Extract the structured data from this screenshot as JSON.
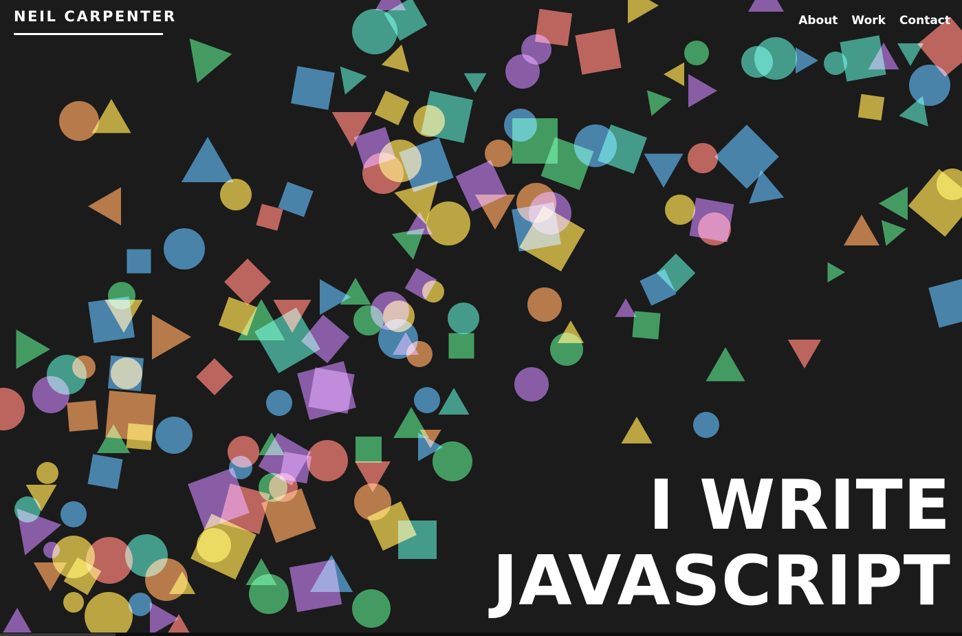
{
  "brand": {
    "name": "NEIL CARPENTER"
  },
  "nav": {
    "items": [
      {
        "label": "About"
      },
      {
        "label": "Work"
      },
      {
        "label": "Contact"
      }
    ]
  },
  "hero": {
    "line1": "I WRITE",
    "line2": "JAVASCRIPT"
  },
  "colors": {
    "background": "#1b1b1b",
    "text": "#ffffff",
    "shape_palette": [
      "#b4534c",
      "#2e8f7c",
      "#3474a0",
      "#b39a2c",
      "#ae6a35",
      "#2e8f4f",
      "#7a4a9a"
    ]
  }
}
